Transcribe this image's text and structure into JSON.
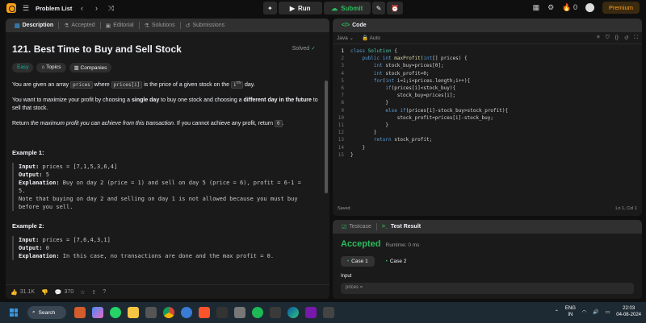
{
  "topbar": {
    "title": "Problem List",
    "run_label": "Run",
    "submit_label": "Submit",
    "streak": "0",
    "premium_label": "Premium"
  },
  "left_tabs": [
    "Description",
    "Accepted",
    "Editorial",
    "Solutions",
    "Submissions"
  ],
  "problem": {
    "title": "121. Best Time to Buy and Sell Stock",
    "status": "Solved",
    "tags": [
      "Easy",
      "Topics",
      "Companies"
    ],
    "p1_a": "You are given an array ",
    "p1_code1": "prices",
    "p1_b": " where ",
    "p1_code2": "prices[i]",
    "p1_c": " is the price of a given stock on the ",
    "p1_sup": "th",
    "p1_d": " day.",
    "p2_a": "You want to maximize your profit by choosing a ",
    "p2_b1": "single day",
    "p2_b": " to buy one stock and choosing a ",
    "p2_b2": "different day in the future",
    "p2_c": " to sell that stock.",
    "p3_a": "Return ",
    "p3_i": "the maximum profit you can achieve from this transaction",
    "p3_b": ". If you cannot achieve any profit, return ",
    "p3_code": "0",
    "p3_c": ".",
    "example1_title": "Example 1:",
    "example1_lines": [
      {
        "label": "Input:",
        "text": " prices = [7,1,5,3,6,4]"
      },
      {
        "label": "Output:",
        "text": " 5"
      },
      {
        "label": "Explanation:",
        "text": " Buy on day 2 (price = 1) and sell on day 5 (price = 6), profit = 6-1 ="
      },
      {
        "label": "",
        "text": "5."
      },
      {
        "label": "",
        "text": "Note that buying on day 2 and selling on day 1 is not allowed because you must buy"
      },
      {
        "label": "",
        "text": "before you sell."
      }
    ],
    "example2_title": "Example 2:",
    "example2_lines": [
      {
        "label": "Input:",
        "text": " prices = [7,6,4,3,1]"
      },
      {
        "label": "Output:",
        "text": " 0"
      },
      {
        "label": "Explanation:",
        "text": " In this case, no transactions are done and the max profit = 0."
      }
    ]
  },
  "bottom_bar": {
    "likes": "31.1K",
    "comments": "370"
  },
  "code_panel": {
    "tab": "Code",
    "language": "Java",
    "mode": "Auto",
    "status": "Saved",
    "cursor": "Ln 1, Col 1",
    "lines": [
      "class Solution {",
      "    public int maxProfit(int[] prices) {",
      "        int stock_buy=prices[0];",
      "        int stock_profit=0;",
      "        for(int i=1;i<prices.length;i++){",
      "            if(prices[i]<stock_buy){",
      "                stock_buy=prices[i];",
      "            }",
      "            else if(prices[i]-stock_buy>stock_profit){",
      "                stock_profit=prices[i]-stock_buy;",
      "            }",
      "        }",
      "        return stock_profit;",
      "    }",
      "}"
    ]
  },
  "test_panel": {
    "tabs": [
      "Testcase",
      "Test Result"
    ],
    "result": "Accepted",
    "runtime": "Runtime: 0 ms",
    "cases": [
      "Case 1",
      "Case 2"
    ],
    "input_label": "Input",
    "input_value": "prices ="
  },
  "taskbar": {
    "search": "Search",
    "lang": "ENG",
    "region": "IN",
    "time": "22:03",
    "date": "04-08-2024"
  }
}
